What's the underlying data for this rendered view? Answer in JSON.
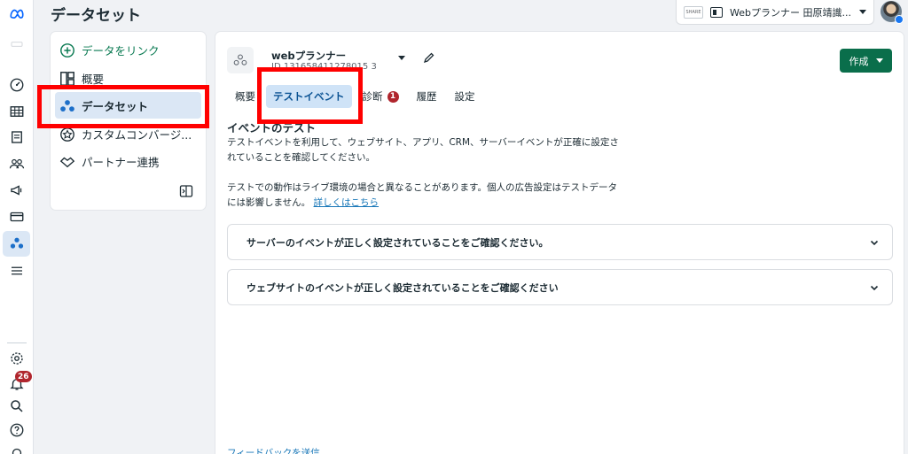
{
  "header": {
    "title": "データセット"
  },
  "account": {
    "logo_text": "SHARE",
    "name": "Webプランナー 田原靖識..."
  },
  "sidebar": {
    "link_label": "データをリンク",
    "items": [
      {
        "label": "概要",
        "icon": "overview-icon"
      },
      {
        "label": "データセット",
        "icon": "dataset-icon"
      },
      {
        "label": "カスタムコンバージ...",
        "icon": "custom-conversion-icon"
      },
      {
        "label": "パートナー連携",
        "icon": "partner-icon"
      }
    ]
  },
  "rail": {
    "notification_count": "26"
  },
  "dataset": {
    "name": "webプランナー",
    "id": "ID 131658411278015 3"
  },
  "toolbar": {
    "create_label": "作成"
  },
  "tabs": [
    {
      "label": "概要"
    },
    {
      "label": "テストイベント"
    },
    {
      "label": "診断",
      "badge": "1"
    },
    {
      "label": "履歴"
    },
    {
      "label": "設定"
    }
  ],
  "content": {
    "section_title": "イベントのテスト",
    "para1": "テストイベントを利用して、ウェブサイト、アプリ、CRM、サーバーイベントが正確に設定されていることを確認してください。",
    "para2": "テストでの動作はライブ環境の場合と異なることがあります。個人の広告設定はテストデータには影響しません。",
    "learn_more": "詳しくはこちら",
    "accordions": [
      {
        "label": "サーバーのイベントが正しく設定されていることをご確認ください。"
      },
      {
        "label": "ウェブサイトのイベントが正しく設定されていることをご確認ください"
      }
    ],
    "feedback": "フィードバックを送信"
  },
  "colors": {
    "accent_green": "#0a6e4b",
    "active_blue": "#dbe7f5",
    "highlight_red": "#ff0000"
  }
}
